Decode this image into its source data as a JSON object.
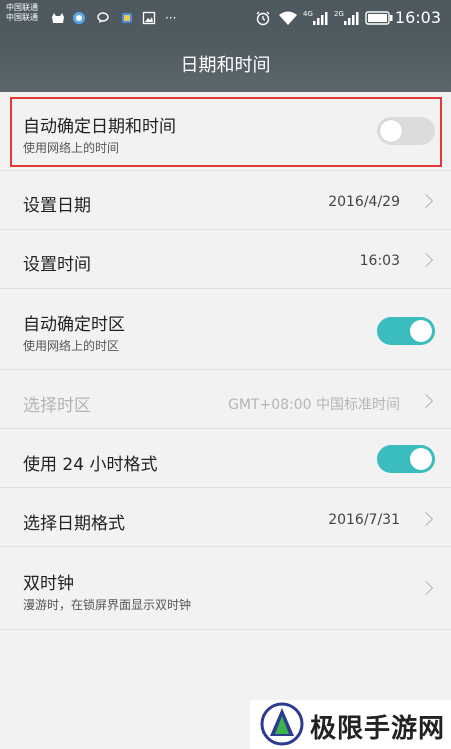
{
  "status_bar": {
    "carrier_1": "中国联通",
    "carrier_2": "中国联通",
    "network_1": "4G",
    "network_2": "2G",
    "time": "16:03",
    "overflow_label": "···",
    "icons": [
      "app-icon",
      "bird-icon",
      "message-icon",
      "app-icon",
      "image-icon",
      "overflow-icon",
      "alarm-icon",
      "wifi-icon",
      "signal-icon",
      "signal-icon",
      "battery-icon"
    ]
  },
  "title_bar": {
    "title": "日期和时间"
  },
  "settings": {
    "auto_datetime": {
      "title": "自动确定日期和时间",
      "subtitle": "使用网络上的时间",
      "enabled": false
    },
    "set_date": {
      "title": "设置日期",
      "value": "2016/4/29"
    },
    "set_time": {
      "title": "设置时间",
      "value": "16:03"
    },
    "auto_timezone": {
      "title": "自动确定时区",
      "subtitle": "使用网络上的时区",
      "enabled": true
    },
    "select_timezone": {
      "title": "选择时区",
      "value": "GMT+08:00 中国标准时间",
      "disabled": true
    },
    "use_24h": {
      "title": "使用 24 小时格式",
      "enabled": true
    },
    "date_format": {
      "title": "选择日期格式",
      "value": "2016/7/31"
    },
    "dual_clock": {
      "title": "双时钟",
      "subtitle": "漫游时，在锁屏界面显示双时钟"
    }
  },
  "watermark": {
    "text": "极限手游网"
  },
  "colors": {
    "toggle_on": "#3bbcbf",
    "toggle_off": "#dcdcdc",
    "highlight": "#e53935",
    "header": "#4e5a5f"
  }
}
